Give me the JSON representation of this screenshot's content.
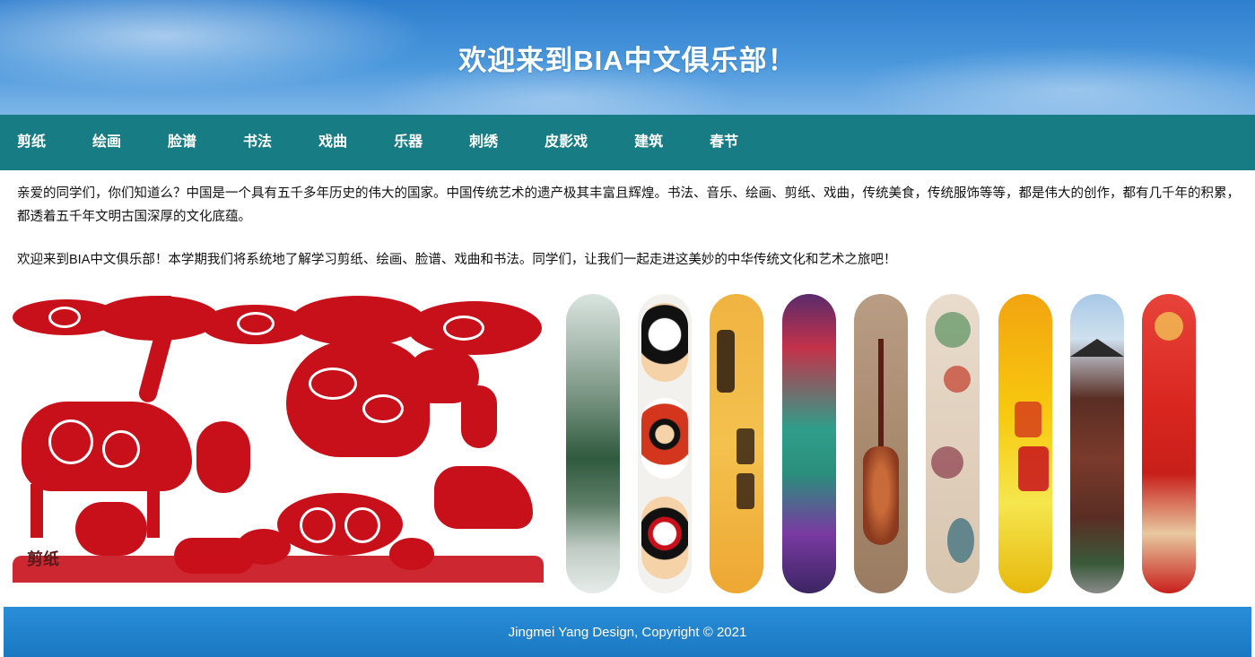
{
  "header": {
    "title": "欢迎来到BIA中文俱乐部！"
  },
  "nav": {
    "items": [
      "剪纸",
      "绘画",
      "脸谱",
      "书法",
      "戏曲",
      "乐器",
      "刺绣",
      "皮影戏",
      "建筑",
      "春节"
    ]
  },
  "intro": {
    "paragraph1": "亲爱的同学们，你们知道么？中国是一个具有五千多年历史的伟大的国家。中国传统艺术的遗产极其丰富且辉煌。书法、音乐、绘画、剪纸、戏曲，传统美食，传统服饰等等，都是伟大的创作，都有几千年的积累，都透着五千年文明古国深厚的文化底蕴。",
    "paragraph2": "欢迎来到BIA中文俱乐部！本学期我们将系统地了解学习剪纸、绘画、脸谱、戏曲和书法。同学们，让我们一起走进这美妙的中华传统文化和艺术之旅吧！"
  },
  "gallery": {
    "main_caption": "剪纸",
    "strip_icons": [
      "landscape-painting",
      "opera-masks",
      "calligraphy",
      "chinese-opera",
      "pipa-instrument",
      "embroidery",
      "shadow-puppet",
      "pagoda-building",
      "spring-festival"
    ]
  },
  "footer": {
    "text": "Jingmei Yang Design, Copyright © 2021"
  }
}
